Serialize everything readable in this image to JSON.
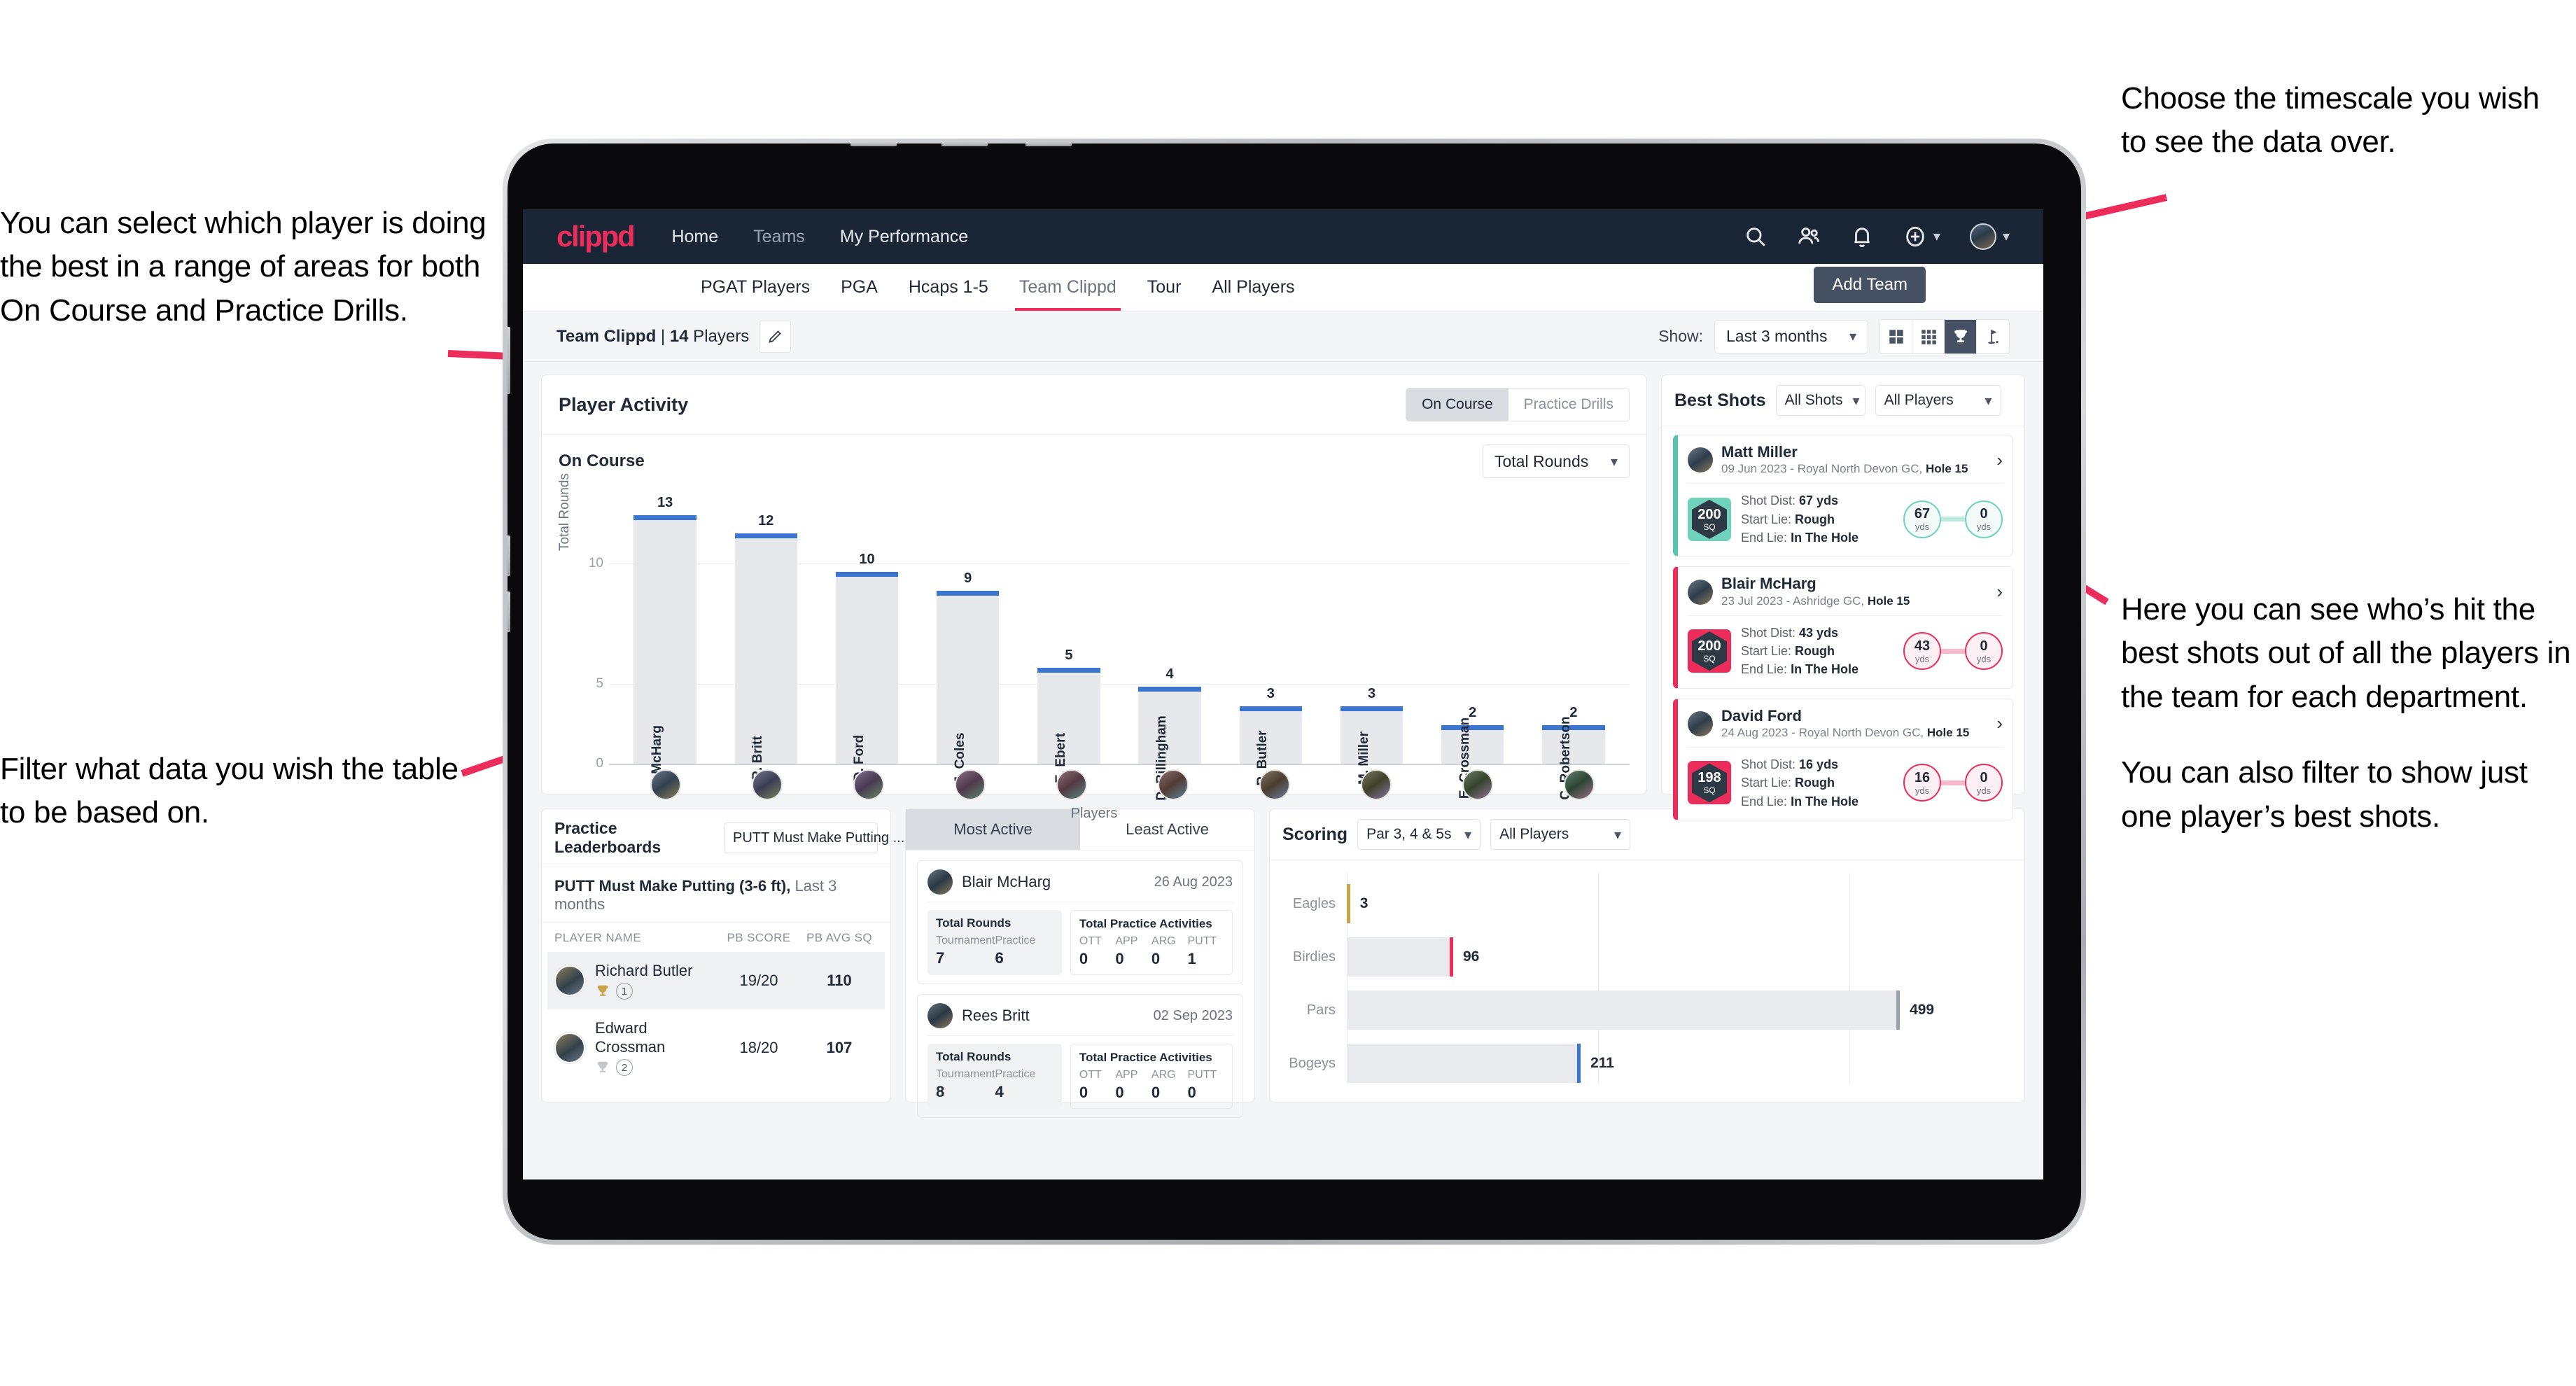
{
  "annotations": {
    "left_top": [
      "You can select which player is doing the best in a range of areas for both On Course and Practice Drills."
    ],
    "left_bottom": [
      "Filter what data you wish the table to be based on."
    ],
    "right_top": [
      "Choose the timescale you wish to see the data over."
    ],
    "right_middle": [
      "Here you can see who’s hit the best shots out of all the players in the team for each department.",
      "You can also filter to show just one player’s best shots."
    ]
  },
  "topnav": {
    "brand": "clippd",
    "links": [
      {
        "label": "Home",
        "dim": false
      },
      {
        "label": "Teams",
        "dim": true
      },
      {
        "label": "My Performance",
        "dim": false
      }
    ],
    "icons": [
      "search-icon",
      "people-icon",
      "bell-icon",
      "plus-circle-icon",
      "avatar"
    ]
  },
  "subnav": {
    "tabs": [
      {
        "label": "PGAT Players",
        "active": false
      },
      {
        "label": "PGA",
        "active": false
      },
      {
        "label": "Hcaps 1-5",
        "active": false
      },
      {
        "label": "Team Clippd",
        "active": true
      },
      {
        "label": "Tour",
        "active": false
      },
      {
        "label": "All Players",
        "active": false
      }
    ],
    "tooltip": "Add Team"
  },
  "toolbar": {
    "team_name": "Team Clippd",
    "team_separator": " | ",
    "player_count": "14",
    "players_word": " Players",
    "edit_icon": "pencil-icon",
    "show_label": "Show:",
    "timescale_value": "Last 3 months",
    "view_toggles": [
      {
        "icon": "grid-2x2-icon",
        "active": false
      },
      {
        "icon": "grid-3x3-icon",
        "active": false
      },
      {
        "icon": "trophy-icon",
        "active": true
      },
      {
        "icon": "golf-flag-icon",
        "active": false
      }
    ]
  },
  "player_activity": {
    "title": "Player Activity",
    "segments": [
      {
        "label": "On Course",
        "active": true
      },
      {
        "label": "Practice Drills",
        "active": false
      }
    ],
    "sub_label": "On Course",
    "metric_value": "Total Rounds"
  },
  "chart_data": [
    {
      "type": "bar",
      "title": "Player Activity – On Course",
      "xlabel": "Players",
      "ylabel": "Total Rounds",
      "categories": [
        "B. McHarg",
        "R. Britt",
        "D. Ford",
        "J. Coles",
        "E. Ebert",
        "D. Billingham",
        "R. Butler",
        "M. Miller",
        "E. Crossman",
        "C. Robertson"
      ],
      "values": [
        13,
        12,
        10,
        9,
        5,
        4,
        3,
        3,
        2,
        2
      ],
      "ylim": [
        0,
        14
      ],
      "yticks": [
        0,
        5,
        10
      ],
      "grid": true,
      "bar_color": "#e6e8ec",
      "bar_cap_color": "#3a75d0"
    },
    {
      "type": "bar",
      "orientation": "horizontal",
      "title": "Scoring",
      "categories": [
        "Eagles",
        "Birdies",
        "Pars",
        "Bogeys"
      ],
      "values": [
        3,
        96,
        499,
        211
      ],
      "xlim": [
        0,
        600
      ],
      "colors": [
        "#c9a24a",
        "#ec2c5a",
        "#9aa1ab",
        "#3a75d0"
      ],
      "grid": true
    }
  ],
  "best_shots": {
    "title": "Best Shots",
    "shot_filter": "All Shots",
    "player_filter": "All Players",
    "cards": [
      {
        "name": "Matt Miller",
        "meta_date": "09 Jun 2023 - Royal North Devon GC, ",
        "meta_hole": "Hole 15",
        "badge_number": "200",
        "badge_unit": "SQ",
        "accent": "teal",
        "shot_dist_label": "Shot Dist: ",
        "shot_dist_value": "67 yds",
        "start_lie_label": "Start Lie: ",
        "start_lie_value": "Rough",
        "end_lie_label": "End Lie: ",
        "end_lie_value": "In The Hole",
        "from_value": "67",
        "from_unit": "yds",
        "to_value": "0",
        "to_unit": "yds"
      },
      {
        "name": "Blair McHarg",
        "meta_date": "23 Jul 2023 - Ashridge GC, ",
        "meta_hole": "Hole 15",
        "badge_number": "200",
        "badge_unit": "SQ",
        "accent": "pink",
        "shot_dist_label": "Shot Dist: ",
        "shot_dist_value": "43 yds",
        "start_lie_label": "Start Lie: ",
        "start_lie_value": "Rough",
        "end_lie_label": "End Lie: ",
        "end_lie_value": "In The Hole",
        "from_value": "43",
        "from_unit": "yds",
        "to_value": "0",
        "to_unit": "yds"
      },
      {
        "name": "David Ford",
        "meta_date": "24 Aug 2023 - Royal North Devon GC, ",
        "meta_hole": "Hole 15",
        "badge_number": "198",
        "badge_unit": "SQ",
        "accent": "pink",
        "shot_dist_label": "Shot Dist: ",
        "shot_dist_value": "16 yds",
        "start_lie_label": "Start Lie: ",
        "start_lie_value": "Rough",
        "end_lie_label": "End Lie: ",
        "end_lie_value": "In The Hole",
        "from_value": "16",
        "from_unit": "yds",
        "to_value": "0",
        "to_unit": "yds"
      }
    ]
  },
  "practice_leaderboards": {
    "title": "Practice Leaderboards",
    "drill_select": "PUTT Must Make Putting ...",
    "subtitle_bold": "PUTT Must Make Putting (3-6 ft),",
    "subtitle_rest": " Last 3 months",
    "columns": [
      "PLAYER NAME",
      "PB SCORE",
      "PB AVG SQ"
    ],
    "rows": [
      {
        "name": "Richard Butler",
        "rank": "1",
        "trophy": "gold",
        "pb_score": "19/20",
        "pb_avg_sq": "110",
        "highlight": true
      },
      {
        "name": "Edward Crossman",
        "rank": "2",
        "trophy": "silver",
        "pb_score": "18/20",
        "pb_avg_sq": "107",
        "highlight": false
      }
    ]
  },
  "activity_panel": {
    "tabs": [
      {
        "label": "Most Active",
        "active": true
      },
      {
        "label": "Least Active",
        "active": false
      }
    ],
    "rounds_title": "Total Rounds",
    "rounds_keys": [
      "Tournament",
      "Practice"
    ],
    "practice_title": "Total Practice Activities",
    "practice_keys": [
      "OTT",
      "APP",
      "ARG",
      "PUTT"
    ],
    "cards": [
      {
        "name": "Blair McHarg",
        "date": "26 Aug 2023",
        "rounds": [
          "7",
          "6"
        ],
        "practice": [
          "0",
          "0",
          "0",
          "1"
        ]
      },
      {
        "name": "Rees Britt",
        "date": "02 Sep 2023",
        "rounds": [
          "8",
          "4"
        ],
        "practice": [
          "0",
          "0",
          "0",
          "0"
        ]
      }
    ]
  },
  "scoring": {
    "title": "Scoring",
    "par_filter": "Par 3, 4 & 5s",
    "player_filter": "All Players",
    "rows": [
      {
        "label": "Eagles",
        "value": "3",
        "color": "gold"
      },
      {
        "label": "Birdies",
        "value": "96",
        "color": "pink"
      },
      {
        "label": "Pars",
        "value": "499",
        "color": "grey"
      },
      {
        "label": "Bogeys",
        "value": "211",
        "color": "blue"
      }
    ]
  },
  "colors": {
    "brand_pink": "#ec2c5a",
    "navy": "#1a2535",
    "teal": "#6fd3bb",
    "blue": "#3a75d0",
    "gold": "#c9a24a",
    "grey": "#9aa1ab"
  }
}
